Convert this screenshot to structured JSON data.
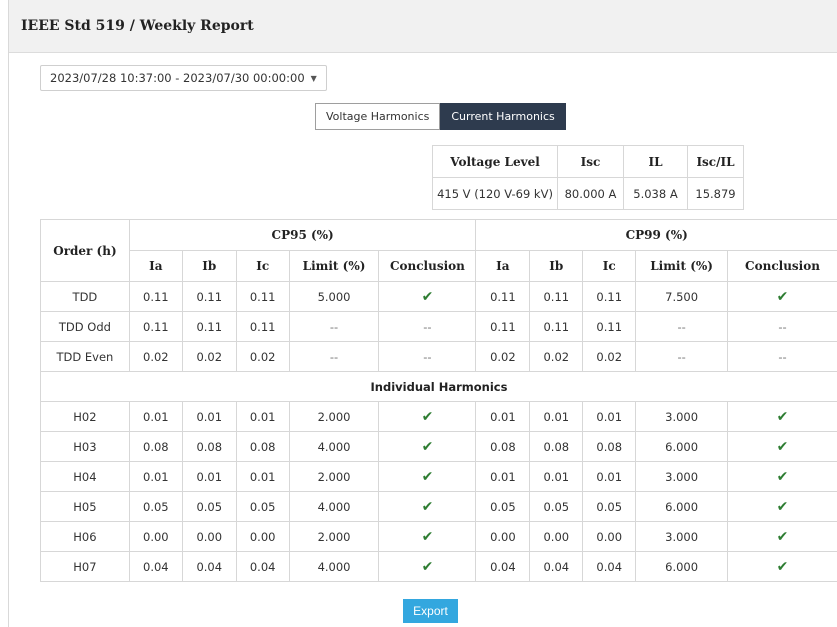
{
  "header": {
    "title": "IEEE Std 519 / Weekly Report"
  },
  "date_range": {
    "value": "2023/07/28 10:37:00 - 2023/07/30 00:00:00"
  },
  "toggle": {
    "voltage_label": "Voltage Harmonics",
    "current_label": "Current Harmonics",
    "active": "current"
  },
  "summary": {
    "headers": [
      "Voltage Level",
      "Isc",
      "IL",
      "Isc/IL"
    ],
    "values": [
      "415 V (120 V-69 kV)",
      "80.000 A",
      "5.038 A",
      "15.879"
    ]
  },
  "main": {
    "order_header": "Order (h)",
    "cp95_header": "CP95 (%)",
    "cp99_header": "CP99 (%)",
    "sub_headers": [
      "Ia",
      "Ib",
      "Ic",
      "Limit (%)",
      "Conclusion"
    ],
    "section_label": "Individual Harmonics",
    "tdd_rows": [
      {
        "order": "TDD",
        "cp95": [
          "0.11",
          "0.11",
          "0.11",
          "5.000",
          "✔"
        ],
        "cp99": [
          "0.11",
          "0.11",
          "0.11",
          "7.500",
          "✔"
        ]
      },
      {
        "order": "TDD Odd",
        "cp95": [
          "0.11",
          "0.11",
          "0.11",
          "--",
          "--"
        ],
        "cp99": [
          "0.11",
          "0.11",
          "0.11",
          "--",
          "--"
        ]
      },
      {
        "order": "TDD Even",
        "cp95": [
          "0.02",
          "0.02",
          "0.02",
          "--",
          "--"
        ],
        "cp99": [
          "0.02",
          "0.02",
          "0.02",
          "--",
          "--"
        ]
      }
    ],
    "harmonic_rows": [
      {
        "order": "H02",
        "cp95": [
          "0.01",
          "0.01",
          "0.01",
          "2.000",
          "✔"
        ],
        "cp99": [
          "0.01",
          "0.01",
          "0.01",
          "3.000",
          "✔"
        ]
      },
      {
        "order": "H03",
        "cp95": [
          "0.08",
          "0.08",
          "0.08",
          "4.000",
          "✔"
        ],
        "cp99": [
          "0.08",
          "0.08",
          "0.08",
          "6.000",
          "✔"
        ]
      },
      {
        "order": "H04",
        "cp95": [
          "0.01",
          "0.01",
          "0.01",
          "2.000",
          "✔"
        ],
        "cp99": [
          "0.01",
          "0.01",
          "0.01",
          "3.000",
          "✔"
        ]
      },
      {
        "order": "H05",
        "cp95": [
          "0.05",
          "0.05",
          "0.05",
          "4.000",
          "✔"
        ],
        "cp99": [
          "0.05",
          "0.05",
          "0.05",
          "6.000",
          "✔"
        ]
      },
      {
        "order": "H06",
        "cp95": [
          "0.00",
          "0.00",
          "0.00",
          "2.000",
          "✔"
        ],
        "cp99": [
          "0.00",
          "0.00",
          "0.00",
          "3.000",
          "✔"
        ]
      },
      {
        "order": "H07",
        "cp95": [
          "0.04",
          "0.04",
          "0.04",
          "4.000",
          "✔"
        ],
        "cp99": [
          "0.04",
          "0.04",
          "0.04",
          "6.000",
          "✔"
        ]
      }
    ]
  },
  "export": {
    "label": "Export"
  },
  "colors": {
    "accent": "#33a7df",
    "active_toggle": "#2e3b4e",
    "check": "#2e7d32"
  }
}
